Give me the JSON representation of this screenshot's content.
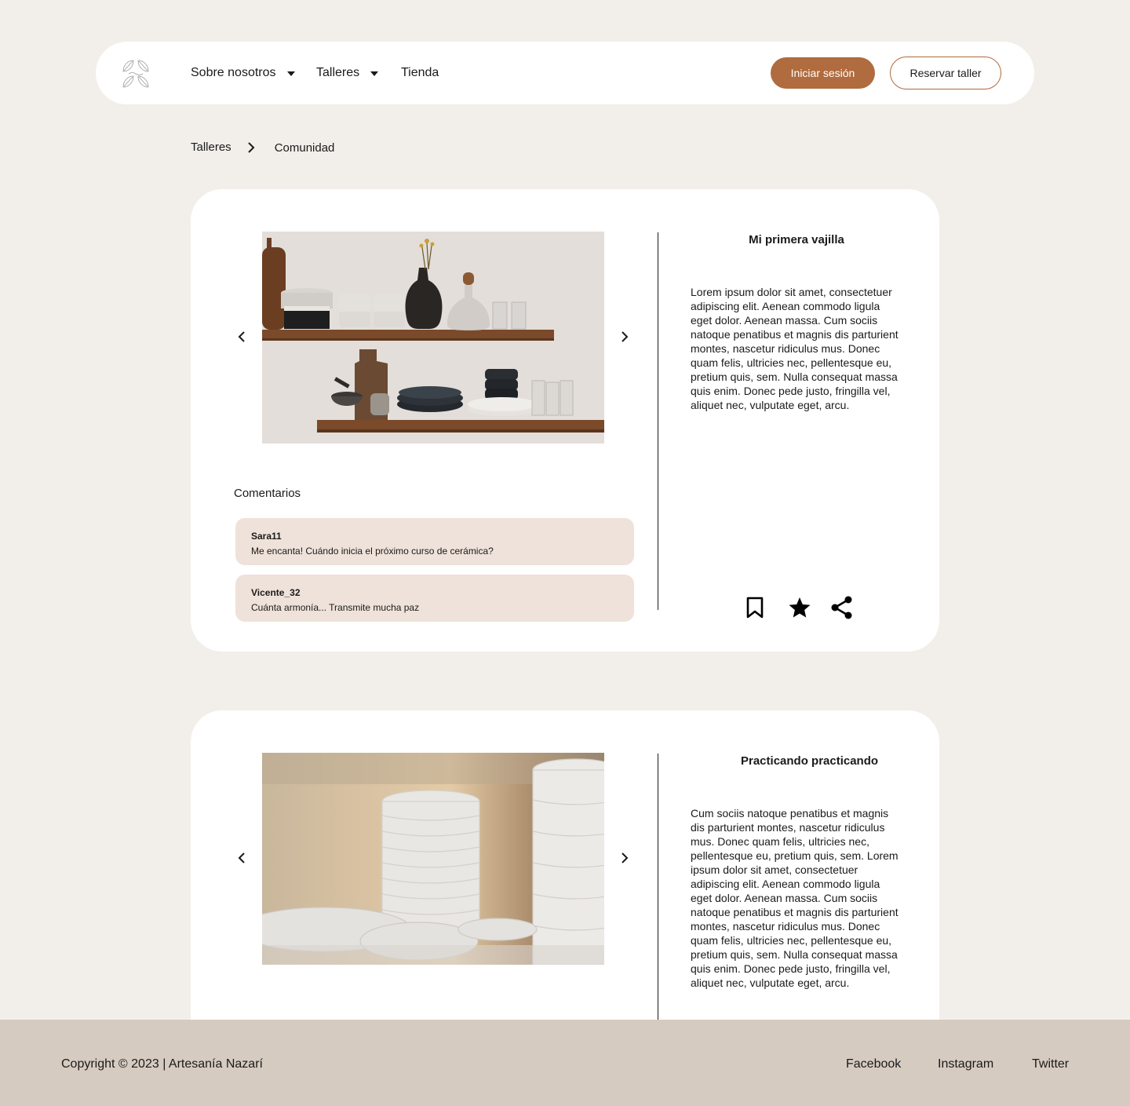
{
  "nav": {
    "logo_icon": "leaf-logo-icon",
    "items": [
      {
        "label": "Sobre nosotros",
        "has_dropdown": true
      },
      {
        "label": "Talleres",
        "has_dropdown": true
      },
      {
        "label": "Tienda",
        "has_dropdown": false
      }
    ],
    "login_label": "Iniciar sesión",
    "book_label": "Reservar taller"
  },
  "breadcrumb": {
    "items": [
      "Talleres",
      "Comunidad"
    ],
    "separator_icon": "chevron-right-icon"
  },
  "posts": [
    {
      "title": "Mi primera vajilla",
      "body": "Lorem ipsum dolor sit amet, consectetuer adipiscing elit. Aenean commodo ligula eget dolor. Aenean massa. Cum sociis natoque penatibus et magnis dis parturient montes, nascetur ridiculus mus. Donec quam felis, ultricies nec, pellentesque eu, pretium quis, sem. Nulla consequat massa quis enim. Donec pede justo, fringilla vel, aliquet nec, vulputate eget, arcu.",
      "comments_title": "Comentarios",
      "comments": [
        {
          "user": "Sara11",
          "text": "Me encanta! Cuándo inicia el próximo curso de cerámica?"
        },
        {
          "user": "Vicente_32",
          "text": "Cuánta armonía... Transmite mucha paz"
        }
      ],
      "actions": [
        "bookmark-icon",
        "star-icon",
        "share-icon"
      ]
    },
    {
      "title": "Practicando practicando",
      "body": "Cum sociis natoque penatibus et magnis dis parturient montes, nascetur ridiculus mus. Donec quam felis, ultricies nec, pellentesque eu, pretium quis, sem. Lorem ipsum dolor sit amet, consectetuer adipiscing elit. Aenean commodo ligula eget dolor. Aenean massa. Cum sociis natoque penatibus et magnis dis parturient montes, nascetur ridiculus mus. Donec quam felis, ultricies nec, pellentesque eu, pretium quis, sem. Nulla consequat massa quis enim. Donec pede justo, fringilla vel, aliquet nec, vulputate eget, arcu."
    }
  ],
  "footer": {
    "copyright": "Copyright © 2023 | Artesanía Nazarí",
    "social": [
      "Facebook",
      "Instagram",
      "Twitter"
    ]
  },
  "colors": {
    "background": "#F2EFEA",
    "accent": "#B06B3E",
    "comment_bg": "#EFE2DA",
    "footer_bg": "#D6CBC0"
  }
}
